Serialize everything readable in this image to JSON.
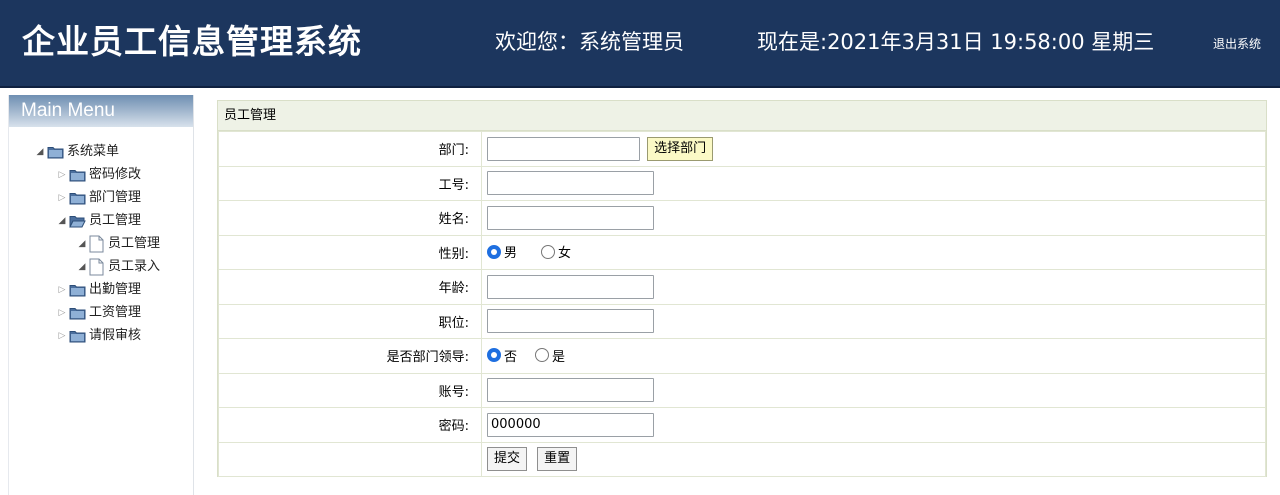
{
  "header": {
    "app_title": "企业员工信息管理系统",
    "welcome": "欢迎您：系统管理员",
    "datetime": "现在是:2021年3月31日 19:58:00 星期三",
    "logout": "退出系统"
  },
  "sidebar": {
    "menu_title": "Main Menu",
    "root": "系统菜单",
    "items": [
      {
        "label": "密码修改"
      },
      {
        "label": "部门管理"
      },
      {
        "label": "员工管理",
        "children": [
          {
            "label": "员工管理"
          },
          {
            "label": "员工录入"
          }
        ]
      },
      {
        "label": "出勤管理"
      },
      {
        "label": "工资管理"
      },
      {
        "label": "请假审核"
      }
    ]
  },
  "panel": {
    "title": "员工管理",
    "fields": {
      "dept_label": "部门:",
      "dept_value": "",
      "select_dept_button": "选择部门",
      "emp_no_label": "工号:",
      "emp_no_value": "",
      "name_label": "姓名:",
      "name_value": "",
      "gender_label": "性别:",
      "gender_options": [
        "男",
        "女"
      ],
      "gender_selected": "男",
      "age_label": "年龄:",
      "age_value": "",
      "position_label": "职位:",
      "position_value": "",
      "is_leader_label": "是否部门领导:",
      "is_leader_options": [
        "否",
        "是"
      ],
      "is_leader_selected": "否",
      "account_label": "账号:",
      "account_value": "",
      "password_label": "密码:",
      "password_value": "000000"
    },
    "buttons": {
      "submit": "提交",
      "reset": "重置"
    }
  },
  "colors": {
    "header_bg": "#1c365e",
    "panel_title_bg": "#eef2e6",
    "select_button_bg": "#fbf9c6",
    "radio_checked": "#1f6fe0"
  },
  "icons": {
    "tree_folder": "folder-icon",
    "tree_leaf": "file-icon"
  }
}
